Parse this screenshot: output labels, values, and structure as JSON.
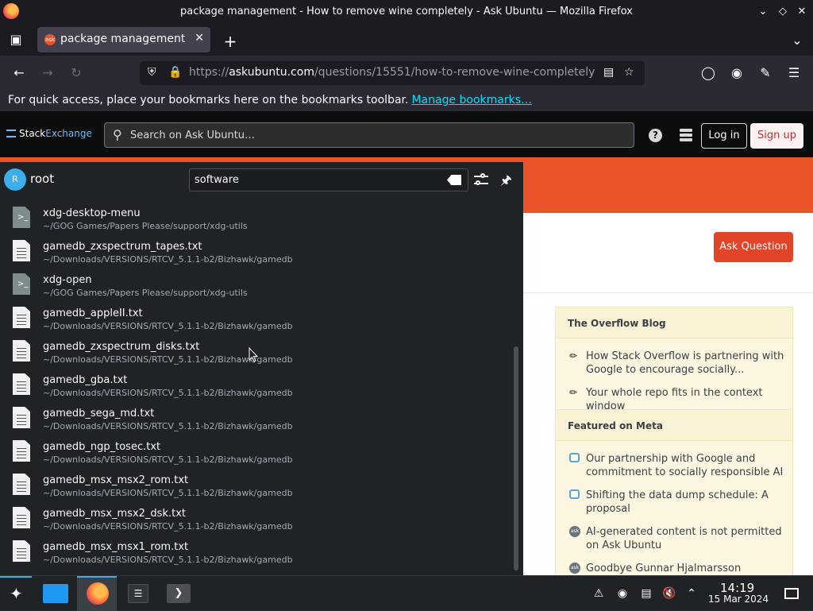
{
  "window": {
    "title": "package management - How to remove wine completely - Ask Ubuntu — Mozilla Firefox"
  },
  "tabs": [
    {
      "label": "package management - Ask Ubuntu",
      "favicon": "ask"
    }
  ],
  "urlbar": {
    "scheme": "https://",
    "domain": "askubuntu.com",
    "path": "/questions/15551/how-to-remove-wine-completely"
  },
  "bookmarks": {
    "message": "For quick access, place your bookmarks here on the bookmarks toolbar.",
    "link": "Manage bookmarks…"
  },
  "site": {
    "logo_stack": "Stack",
    "logo_exchange": "Exchange",
    "search_placeholder": "Search on Ask Ubuntu…",
    "help": "?",
    "login": "Log in",
    "signup": "Sign up",
    "ask_question": "Ask Question"
  },
  "sidebar": {
    "blog_heading": "The Overflow Blog",
    "blog_items": [
      "How Stack Overflow is partnering with Google to encourage socially...",
      "Your whole repo fits in the context window"
    ],
    "meta_heading": "Featured on Meta",
    "meta_items": [
      "Our partnership with Google and commitment to socially responsible AI",
      "Shifting the data dump schedule: A proposal",
      "AI-generated content is not permitted on Ask Ubuntu",
      "Goodbye Gunnar Hjalmarsson"
    ],
    "au_badge": "ask"
  },
  "krunner": {
    "avatar_letter": "R",
    "user": "root",
    "query": "software",
    "results": [
      {
        "name": "xdg-desktop-menu",
        "path": "~/GOG Games/Papers Please/support/xdg-utils",
        "icon": "script"
      },
      {
        "name": "gamedb_zxspectrum_tapes.txt",
        "path": "~/Downloads/VERSIONS/RTCV_5.1.1-b2/Bizhawk/gamedb",
        "icon": "text"
      },
      {
        "name": "xdg-open",
        "path": "~/GOG Games/Papers Please/support/xdg-utils",
        "icon": "script"
      },
      {
        "name": "gamedb_appleII.txt",
        "path": "~/Downloads/VERSIONS/RTCV_5.1.1-b2/Bizhawk/gamedb",
        "icon": "text"
      },
      {
        "name": "gamedb_zxspectrum_disks.txt",
        "path": "~/Downloads/VERSIONS/RTCV_5.1.1-b2/Bizhawk/gamedb",
        "icon": "text"
      },
      {
        "name": "gamedb_gba.txt",
        "path": "~/Downloads/VERSIONS/RTCV_5.1.1-b2/Bizhawk/gamedb",
        "icon": "text"
      },
      {
        "name": "gamedb_sega_md.txt",
        "path": "~/Downloads/VERSIONS/RTCV_5.1.1-b2/Bizhawk/gamedb",
        "icon": "text"
      },
      {
        "name": "gamedb_ngp_tosec.txt",
        "path": "~/Downloads/VERSIONS/RTCV_5.1.1-b2/Bizhawk/gamedb",
        "icon": "text"
      },
      {
        "name": "gamedb_msx_msx2_rom.txt",
        "path": "~/Downloads/VERSIONS/RTCV_5.1.1-b2/Bizhawk/gamedb",
        "icon": "text"
      },
      {
        "name": "gamedb_msx_msx2_dsk.txt",
        "path": "~/Downloads/VERSIONS/RTCV_5.1.1-b2/Bizhawk/gamedb",
        "icon": "text"
      },
      {
        "name": "gamedb_msx_msx1_rom.txt",
        "path": "~/Downloads/VERSIONS/RTCV_5.1.1-b2/Bizhawk/gamedb",
        "icon": "text"
      }
    ]
  },
  "taskbar": {
    "time": "14:19",
    "date": "15 Mar 2024"
  },
  "colors": {
    "ask_ubuntu_orange": "#e9542b",
    "accent_blue": "#3daee9",
    "link_cyan": "#00ddff"
  }
}
